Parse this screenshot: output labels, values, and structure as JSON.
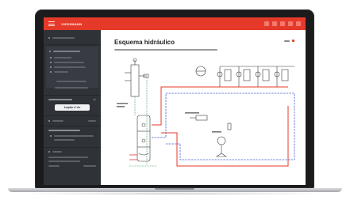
{
  "header": {
    "logo_text": "VIESSMANN"
  },
  "main": {
    "title": "Esquema hidráulico"
  },
  "sidebar": {
    "button_label": "Ampliar & Ver"
  },
  "colors": {
    "accent": "#e53a2a",
    "sidebar_bg": "#2f3237",
    "flow_pipe": "#e53a2a",
    "return_pipe": "#4a5fd0",
    "diagram_line": "#3a3a3a"
  },
  "icons": [
    "menu-icon",
    "notification-icon",
    "help-icon",
    "settings-icon",
    "user-icon",
    "close-icon"
  ]
}
